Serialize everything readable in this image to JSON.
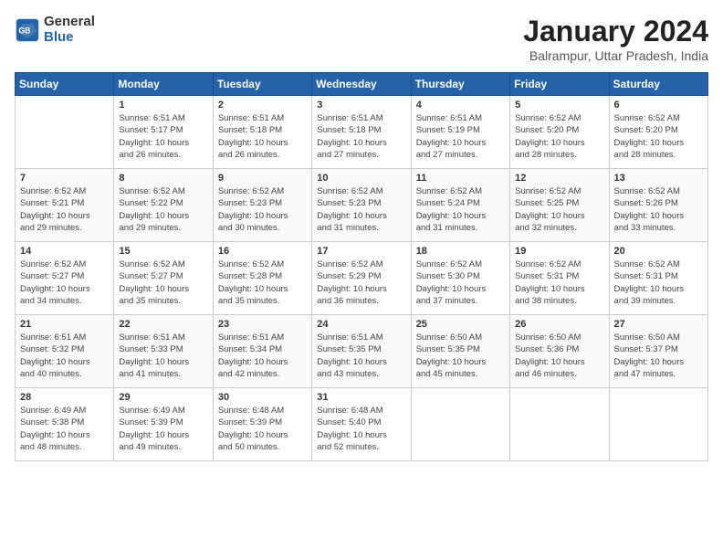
{
  "header": {
    "logo_general": "General",
    "logo_blue": "Blue",
    "title": "January 2024",
    "subtitle": "Balrampur, Uttar Pradesh, India"
  },
  "days_of_week": [
    "Sunday",
    "Monday",
    "Tuesday",
    "Wednesday",
    "Thursday",
    "Friday",
    "Saturday"
  ],
  "weeks": [
    [
      {
        "num": "",
        "info": ""
      },
      {
        "num": "1",
        "info": "Sunrise: 6:51 AM\nSunset: 5:17 PM\nDaylight: 10 hours\nand 26 minutes."
      },
      {
        "num": "2",
        "info": "Sunrise: 6:51 AM\nSunset: 5:18 PM\nDaylight: 10 hours\nand 26 minutes."
      },
      {
        "num": "3",
        "info": "Sunrise: 6:51 AM\nSunset: 5:18 PM\nDaylight: 10 hours\nand 27 minutes."
      },
      {
        "num": "4",
        "info": "Sunrise: 6:51 AM\nSunset: 5:19 PM\nDaylight: 10 hours\nand 27 minutes."
      },
      {
        "num": "5",
        "info": "Sunrise: 6:52 AM\nSunset: 5:20 PM\nDaylight: 10 hours\nand 28 minutes."
      },
      {
        "num": "6",
        "info": "Sunrise: 6:52 AM\nSunset: 5:20 PM\nDaylight: 10 hours\nand 28 minutes."
      }
    ],
    [
      {
        "num": "7",
        "info": "Sunrise: 6:52 AM\nSunset: 5:21 PM\nDaylight: 10 hours\nand 29 minutes."
      },
      {
        "num": "8",
        "info": "Sunrise: 6:52 AM\nSunset: 5:22 PM\nDaylight: 10 hours\nand 29 minutes."
      },
      {
        "num": "9",
        "info": "Sunrise: 6:52 AM\nSunset: 5:23 PM\nDaylight: 10 hours\nand 30 minutes."
      },
      {
        "num": "10",
        "info": "Sunrise: 6:52 AM\nSunset: 5:23 PM\nDaylight: 10 hours\nand 31 minutes."
      },
      {
        "num": "11",
        "info": "Sunrise: 6:52 AM\nSunset: 5:24 PM\nDaylight: 10 hours\nand 31 minutes."
      },
      {
        "num": "12",
        "info": "Sunrise: 6:52 AM\nSunset: 5:25 PM\nDaylight: 10 hours\nand 32 minutes."
      },
      {
        "num": "13",
        "info": "Sunrise: 6:52 AM\nSunset: 5:26 PM\nDaylight: 10 hours\nand 33 minutes."
      }
    ],
    [
      {
        "num": "14",
        "info": "Sunrise: 6:52 AM\nSunset: 5:27 PM\nDaylight: 10 hours\nand 34 minutes."
      },
      {
        "num": "15",
        "info": "Sunrise: 6:52 AM\nSunset: 5:27 PM\nDaylight: 10 hours\nand 35 minutes."
      },
      {
        "num": "16",
        "info": "Sunrise: 6:52 AM\nSunset: 5:28 PM\nDaylight: 10 hours\nand 35 minutes."
      },
      {
        "num": "17",
        "info": "Sunrise: 6:52 AM\nSunset: 5:29 PM\nDaylight: 10 hours\nand 36 minutes."
      },
      {
        "num": "18",
        "info": "Sunrise: 6:52 AM\nSunset: 5:30 PM\nDaylight: 10 hours\nand 37 minutes."
      },
      {
        "num": "19",
        "info": "Sunrise: 6:52 AM\nSunset: 5:31 PM\nDaylight: 10 hours\nand 38 minutes."
      },
      {
        "num": "20",
        "info": "Sunrise: 6:52 AM\nSunset: 5:31 PM\nDaylight: 10 hours\nand 39 minutes."
      }
    ],
    [
      {
        "num": "21",
        "info": "Sunrise: 6:51 AM\nSunset: 5:32 PM\nDaylight: 10 hours\nand 40 minutes."
      },
      {
        "num": "22",
        "info": "Sunrise: 6:51 AM\nSunset: 5:33 PM\nDaylight: 10 hours\nand 41 minutes."
      },
      {
        "num": "23",
        "info": "Sunrise: 6:51 AM\nSunset: 5:34 PM\nDaylight: 10 hours\nand 42 minutes."
      },
      {
        "num": "24",
        "info": "Sunrise: 6:51 AM\nSunset: 5:35 PM\nDaylight: 10 hours\nand 43 minutes."
      },
      {
        "num": "25",
        "info": "Sunrise: 6:50 AM\nSunset: 5:35 PM\nDaylight: 10 hours\nand 45 minutes."
      },
      {
        "num": "26",
        "info": "Sunrise: 6:50 AM\nSunset: 5:36 PM\nDaylight: 10 hours\nand 46 minutes."
      },
      {
        "num": "27",
        "info": "Sunrise: 6:50 AM\nSunset: 5:37 PM\nDaylight: 10 hours\nand 47 minutes."
      }
    ],
    [
      {
        "num": "28",
        "info": "Sunrise: 6:49 AM\nSunset: 5:38 PM\nDaylight: 10 hours\nand 48 minutes."
      },
      {
        "num": "29",
        "info": "Sunrise: 6:49 AM\nSunset: 5:39 PM\nDaylight: 10 hours\nand 49 minutes."
      },
      {
        "num": "30",
        "info": "Sunrise: 6:48 AM\nSunset: 5:39 PM\nDaylight: 10 hours\nand 50 minutes."
      },
      {
        "num": "31",
        "info": "Sunrise: 6:48 AM\nSunset: 5:40 PM\nDaylight: 10 hours\nand 52 minutes."
      },
      {
        "num": "",
        "info": ""
      },
      {
        "num": "",
        "info": ""
      },
      {
        "num": "",
        "info": ""
      }
    ]
  ]
}
